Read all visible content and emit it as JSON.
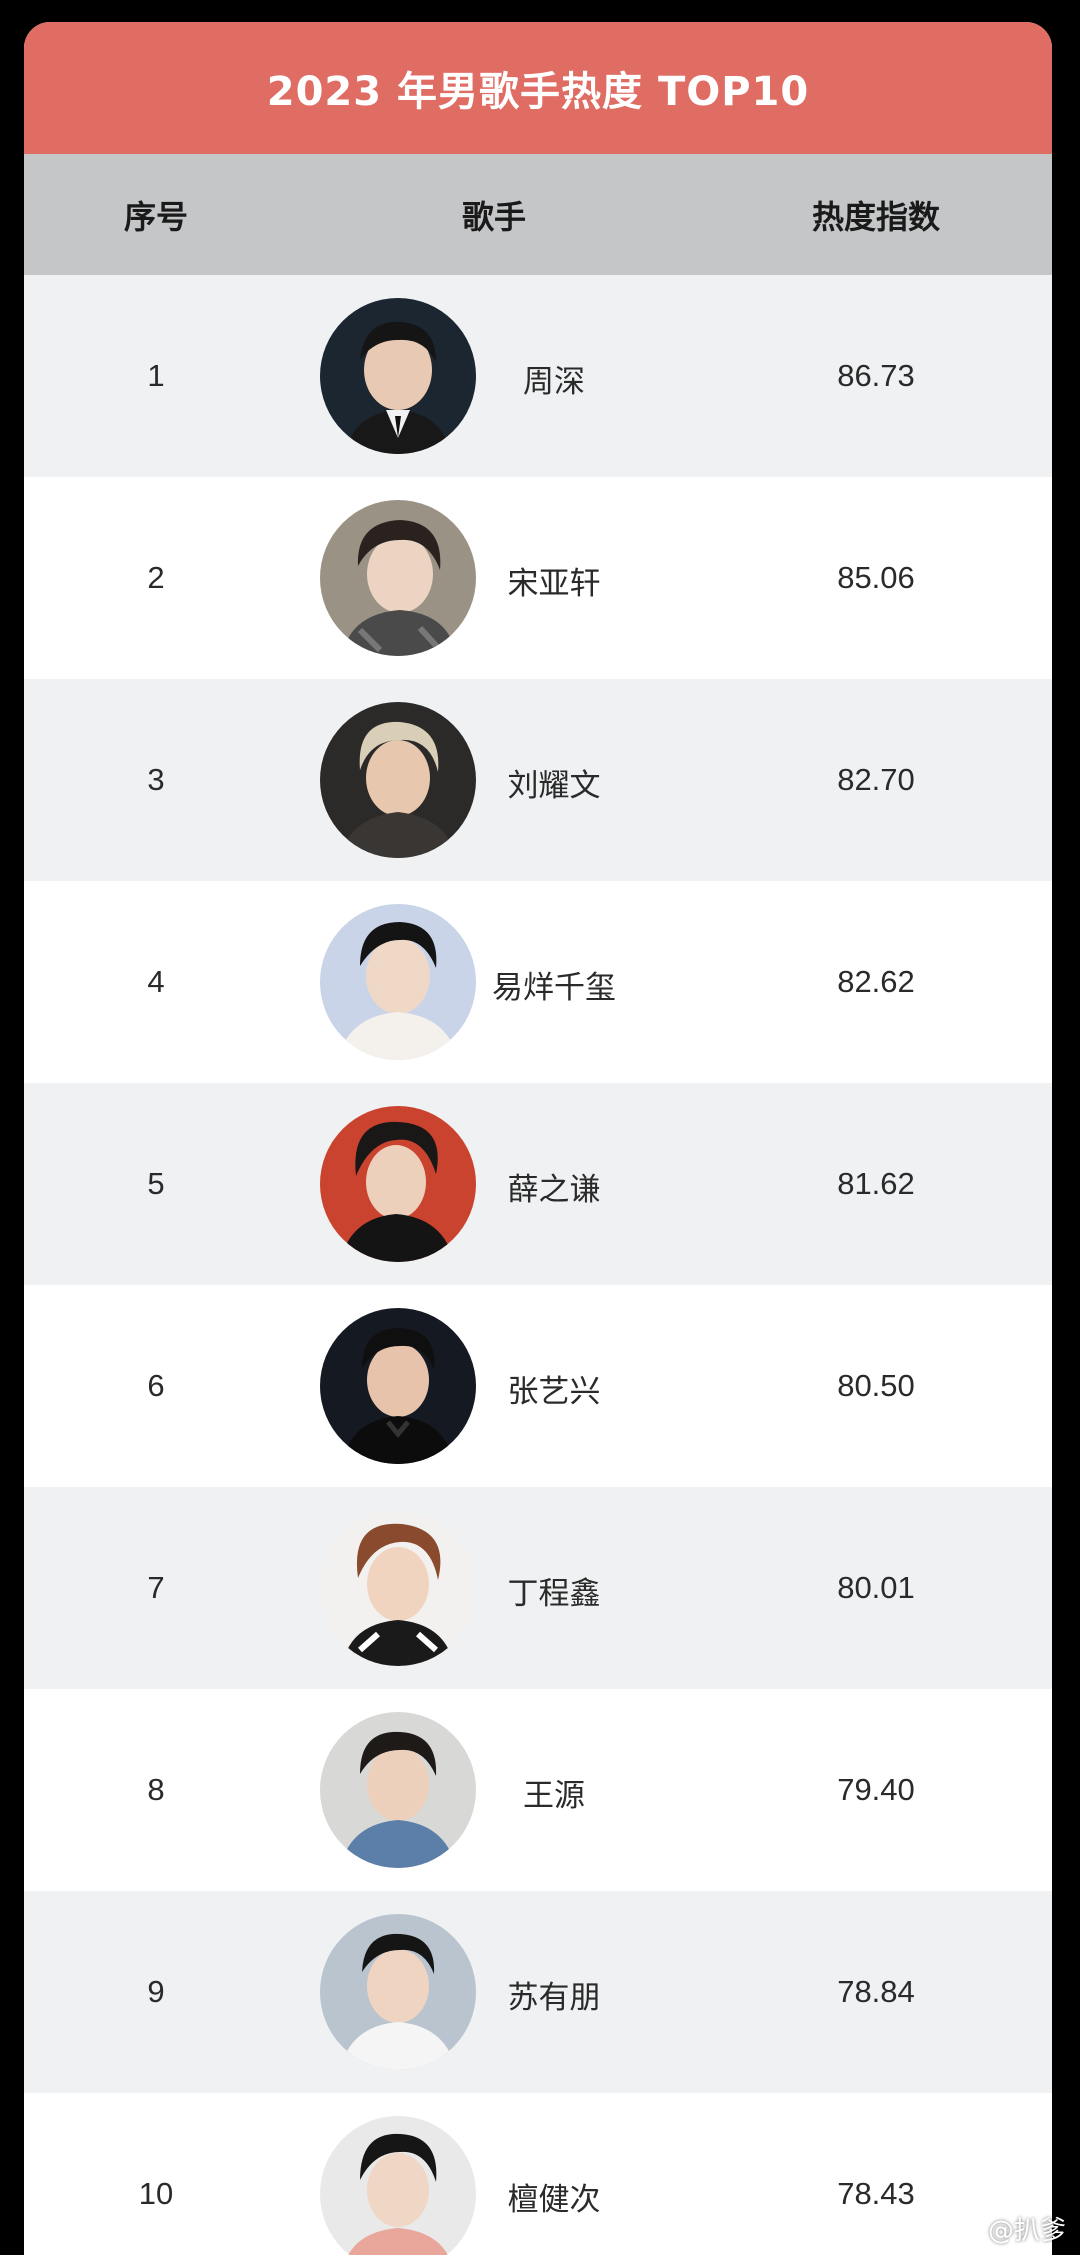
{
  "title": "2023 年男歌手热度 TOP10",
  "colors": {
    "title_bg": "#e06d63",
    "header_bg": "#c4c6c8",
    "row_alt_bg": "#f0f1f3",
    "row_bg": "#ffffff"
  },
  "table": {
    "headers": {
      "rank": "序号",
      "singer": "歌手",
      "heat": "热度指数"
    },
    "rows": [
      {
        "rank": "1",
        "name": "周深",
        "heat": "86.73"
      },
      {
        "rank": "2",
        "name": "宋亚轩",
        "heat": "85.06"
      },
      {
        "rank": "3",
        "name": "刘耀文",
        "heat": "82.70"
      },
      {
        "rank": "4",
        "name": "易烊千玺",
        "heat": "82.62"
      },
      {
        "rank": "5",
        "name": "薛之谦",
        "heat": "81.62"
      },
      {
        "rank": "6",
        "name": "张艺兴",
        "heat": "80.50"
      },
      {
        "rank": "7",
        "name": "丁程鑫",
        "heat": "80.01"
      },
      {
        "rank": "8",
        "name": "王源",
        "heat": "79.40"
      },
      {
        "rank": "9",
        "name": "苏有朋",
        "heat": "78.84"
      },
      {
        "rank": "10",
        "name": "檀健次",
        "heat": "78.43"
      }
    ]
  },
  "watermark": {
    "icon": "weibo-icon",
    "text": "@扒爹"
  }
}
